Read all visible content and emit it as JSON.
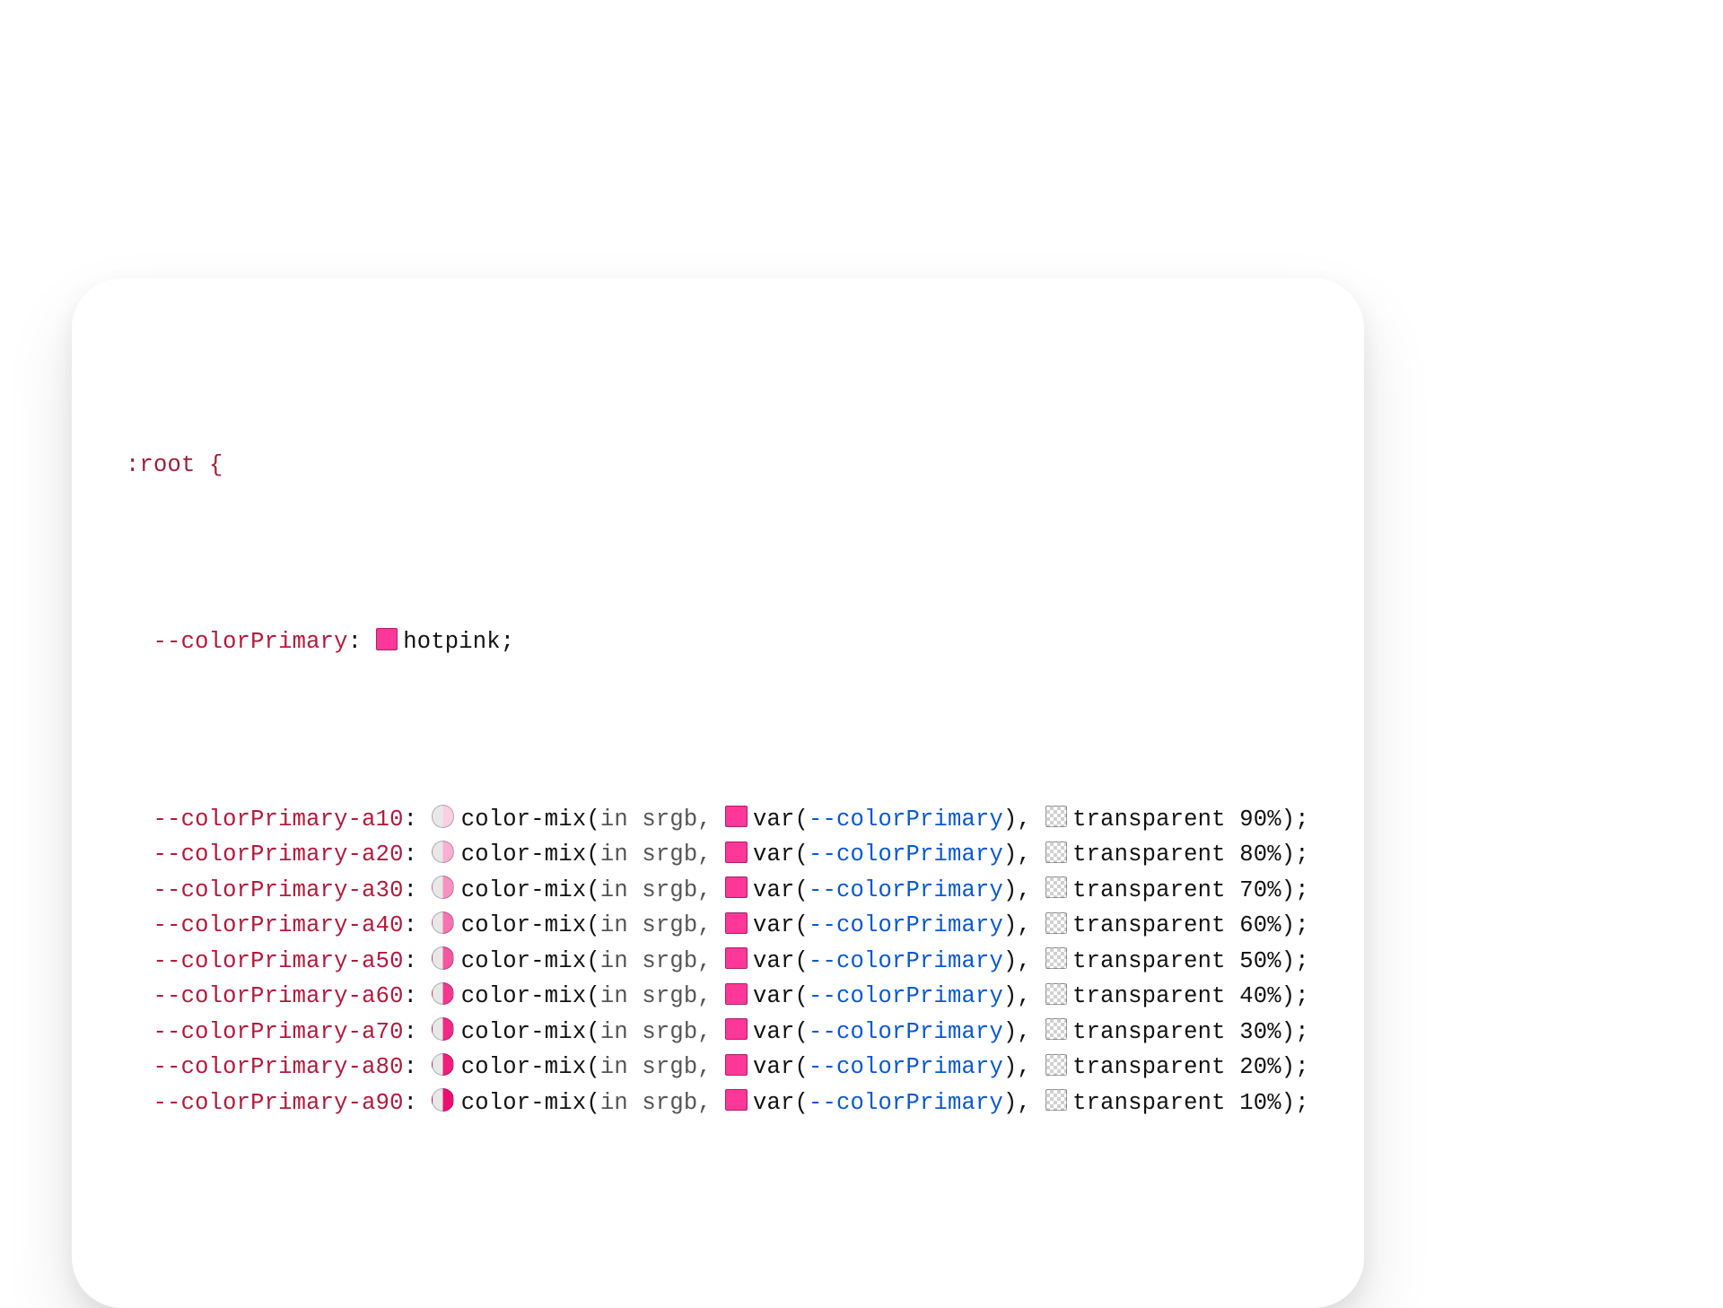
{
  "css": {
    "selector": ":root {",
    "close_brace_visible": false,
    "base": {
      "prop": "--colorPrimary",
      "colon": ": ",
      "swatch_color": "#ff3798",
      "value": "hotpink",
      "semicolon": ";"
    },
    "mix_fn_open": "color-mix(",
    "mix_args_space": "in srgb, ",
    "var_fn": "var",
    "var_open": "(",
    "var_name": "--colorPrimary",
    "var_close": ")",
    "comma_sep": ", ",
    "transparent_word": "transparent ",
    "close_paren_semi": ");",
    "hotpink_hex": "#ff3798",
    "lines": [
      {
        "prop": "--colorPrimary-a10",
        "pct": "90%",
        "mix_left_color": "#fbcfe3",
        "mix_right_color": "#e8e8e8"
      },
      {
        "prop": "--colorPrimary-a20",
        "pct": "80%",
        "mix_left_color": "#fab0d2",
        "mix_right_color": "#e8e8e8"
      },
      {
        "prop": "--colorPrimary-a30",
        "pct": "70%",
        "mix_left_color": "#f892c2",
        "mix_right_color": "#e8e8e8"
      },
      {
        "prop": "--colorPrimary-a40",
        "pct": "60%",
        "mix_left_color": "#f774b1",
        "mix_right_color": "#e8e8e8"
      },
      {
        "prop": "--colorPrimary-a50",
        "pct": "50%",
        "mix_left_color": "#f556a0",
        "mix_right_color": "#e8e8e8"
      },
      {
        "prop": "--colorPrimary-a60",
        "pct": "40%",
        "mix_left_color": "#f43890",
        "mix_right_color": "#e8e8e8"
      },
      {
        "prop": "--colorPrimary-a70",
        "pct": "30%",
        "mix_left_color": "#f22a86",
        "mix_right_color": "#e8e8e8"
      },
      {
        "prop": "--colorPrimary-a80",
        "pct": "20%",
        "mix_left_color": "#f11c7c",
        "mix_right_color": "#e8e8e8"
      },
      {
        "prop": "--colorPrimary-a90",
        "pct": "10%",
        "mix_left_color": "#ef0e72",
        "mix_right_color": "#e8e8e8"
      }
    ]
  }
}
